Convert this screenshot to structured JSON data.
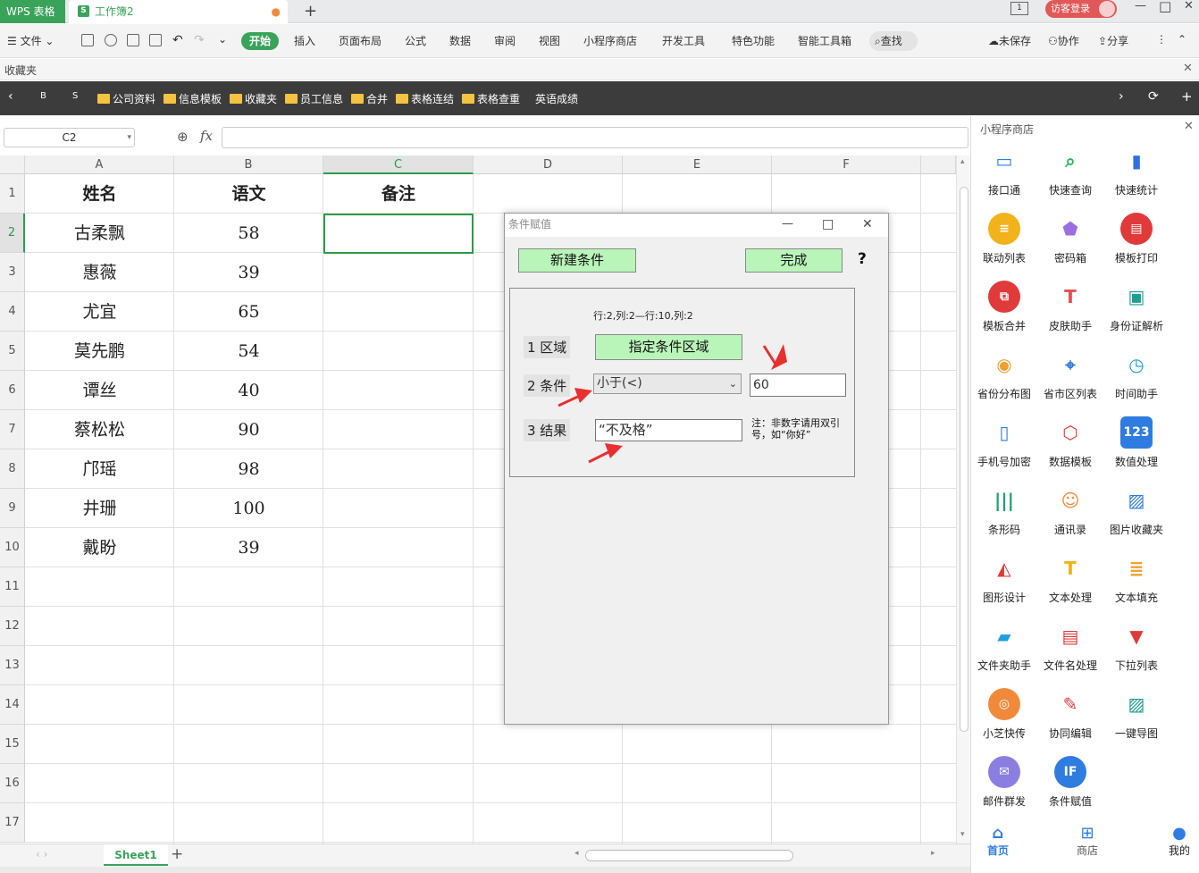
{
  "titlebar": {
    "app_tab": "WPS 表格",
    "doc_tab": "工作簿2",
    "doc_badge": "S",
    "modified_dot": "●",
    "new_tab": "+",
    "guest_login": "访客登录",
    "window_min": "—",
    "window_max": "□",
    "window_close": "✕"
  },
  "menubar": {
    "file": "文件",
    "start": "开始",
    "items": [
      "插入",
      "页面布局",
      "公式",
      "数据",
      "审阅",
      "视图",
      "小程序商店",
      "开发工具",
      "特色功能",
      "智能工具箱"
    ],
    "search": "查找",
    "unsaved": "未保存",
    "collab": "协作",
    "share": "分享"
  },
  "favorites": {
    "label": "收藏夹",
    "left_items": [
      "B",
      "S"
    ],
    "folders": [
      "公司资料",
      "信息模板",
      "收藏夹",
      "员工信息",
      "合并",
      "表格连结",
      "表格查重"
    ],
    "plain": "英语成绩"
  },
  "formula": {
    "name_box": "C2",
    "fx": "fx",
    "value": ""
  },
  "sheet": {
    "columns": [
      "A",
      "B",
      "C",
      "D",
      "E",
      "F"
    ],
    "rows": [
      "1",
      "2",
      "3",
      "4",
      "5",
      "6",
      "7",
      "8",
      "9",
      "10",
      "11",
      "12",
      "13",
      "14",
      "15",
      "16",
      "17"
    ],
    "header": [
      "姓名",
      "语文",
      "备注"
    ],
    "data": [
      [
        "古柔飘",
        "58"
      ],
      [
        "惠薇",
        "39"
      ],
      [
        "尤宜",
        "65"
      ],
      [
        "莫先鹏",
        "54"
      ],
      [
        "谭丝",
        "40"
      ],
      [
        "蔡松松",
        "90"
      ],
      [
        "邝瑶",
        "98"
      ],
      [
        "井珊",
        "100"
      ],
      [
        "戴盼",
        "39"
      ]
    ],
    "tab": "Sheet1",
    "add_sheet": "+"
  },
  "dialog": {
    "title": "条件赋值",
    "new_condition": "新建条件",
    "done": "完成",
    "help": "?",
    "range_info": "行:2,列:2—行:10,列:2",
    "step1": "1 区域",
    "specify_range": "指定条件区域",
    "step2": "2 条件",
    "condition": "小于(<)",
    "condition_value": "60",
    "step3": "3 结果",
    "result": "“不及格”",
    "note": "注：非数字请用双引号，如“你好”"
  },
  "sidebar": {
    "title": "小程序商店",
    "apps": [
      {
        "label": "接口通",
        "icon": "monitor-icon",
        "color": "#2f7ce0"
      },
      {
        "label": "快速查询",
        "icon": "magnifier-icon",
        "color": "#22b35a"
      },
      {
        "label": "快速统计",
        "icon": "bar-chart-icon",
        "color": "#2f6fe0"
      },
      {
        "label": "联动列表",
        "icon": "list-icon",
        "color": "#f2b21b"
      },
      {
        "label": "密码箱",
        "icon": "shield-key-icon",
        "color": "#9b6fe0"
      },
      {
        "label": "模板打印",
        "icon": "printer-icon",
        "color": "#e03a3a"
      },
      {
        "label": "模板合并",
        "icon": "merge-icon",
        "color": "#e03a3a"
      },
      {
        "label": "皮肤助手",
        "icon": "tshirt-icon",
        "color": "#e34f4f"
      },
      {
        "label": "身份证解析",
        "icon": "id-card-icon",
        "color": "#1ea08f"
      },
      {
        "label": "省份分布图",
        "icon": "map-china-icon",
        "color": "#f0a030"
      },
      {
        "label": "省市区列表",
        "icon": "location-pin-icon",
        "color": "#2f7ce0"
      },
      {
        "label": "时间助手",
        "icon": "clock-icon",
        "color": "#1ea0c8"
      },
      {
        "label": "手机号加密",
        "icon": "phone-icon",
        "color": "#2f7ce0"
      },
      {
        "label": "数据模板",
        "icon": "network-icon",
        "color": "#e03a3a"
      },
      {
        "label": "数值处理",
        "icon": "number-123-icon",
        "color": "#2f7ce0"
      },
      {
        "label": "条形码",
        "icon": "barcode-icon",
        "color": "#22a06a"
      },
      {
        "label": "通讯录",
        "icon": "contacts-icon",
        "color": "#f08a3a"
      },
      {
        "label": "图片收藏夹",
        "icon": "picture-icon",
        "color": "#2f7ce0"
      },
      {
        "label": "图形设计",
        "icon": "shapes-icon",
        "color": "#e03a3a"
      },
      {
        "label": "文本处理",
        "icon": "text-t-icon",
        "color": "#f2b21b"
      },
      {
        "label": "文本填充",
        "icon": "document-icon",
        "color": "#f0a030"
      },
      {
        "label": "文件夹助手",
        "icon": "folder-icon",
        "color": "#1ea0e0"
      },
      {
        "label": "文件名处理",
        "icon": "files-icon",
        "color": "#e03a3a"
      },
      {
        "label": "下拉列表",
        "icon": "dropdown-triangle-icon",
        "color": "#e03a3a"
      },
      {
        "label": "小芝快传",
        "icon": "broadcast-icon",
        "color": "#f08a3a"
      },
      {
        "label": "协同编辑",
        "icon": "co-edit-icon",
        "color": "#e03a3a"
      },
      {
        "label": "一键导图",
        "icon": "image-export-icon",
        "color": "#1ea08f"
      },
      {
        "label": "邮件群发",
        "icon": "mail-icon",
        "color": "#8a7fe0"
      },
      {
        "label": "条件赋值",
        "icon": "if-icon",
        "color": "#2f7ce0"
      }
    ],
    "nav": [
      "首页",
      "商店",
      "我的"
    ]
  }
}
